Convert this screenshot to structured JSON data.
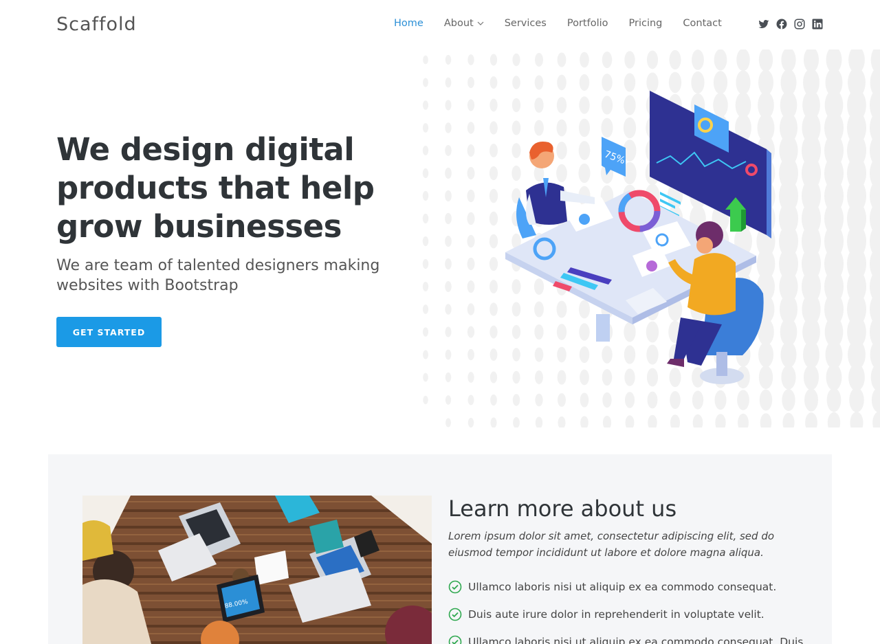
{
  "brand": {
    "logo": "Scaffold"
  },
  "nav": {
    "items": [
      {
        "label": "Home",
        "active": true
      },
      {
        "label": "About",
        "dropdown": true
      },
      {
        "label": "Services"
      },
      {
        "label": "Portfolio"
      },
      {
        "label": "Pricing"
      },
      {
        "label": "Contact"
      }
    ],
    "socials": [
      "twitter-icon",
      "facebook-icon",
      "instagram-icon",
      "linkedin-icon"
    ]
  },
  "hero": {
    "title": "We design digital products that help grow businesses",
    "subtitle": "We are team of talented designers making websites with Bootstrap",
    "cta_label": "GET STARTED",
    "illustration_badge": "75%"
  },
  "about": {
    "title": "Learn more about us",
    "lead": "Lorem ipsum dolor sit amet, consectetur adipiscing elit, sed do eiusmod tempor incididunt ut labore et dolore magna aliqua.",
    "items": [
      "Ullamco laboris nisi ut aliquip ex ea commodo consequat.",
      "Duis aute irure dolor in reprehenderit in voluptate velit.",
      "Ullamco laboris nisi ut aliquip ex ea commodo consequat. Duis"
    ],
    "photo_tablet_text": "88.00%"
  },
  "colors": {
    "accent": "#1b9ae6",
    "nav_active": "#2b8fd6",
    "heading": "#2f3438",
    "check": "#2fa84f",
    "section_bg": "#f5f6f8"
  }
}
